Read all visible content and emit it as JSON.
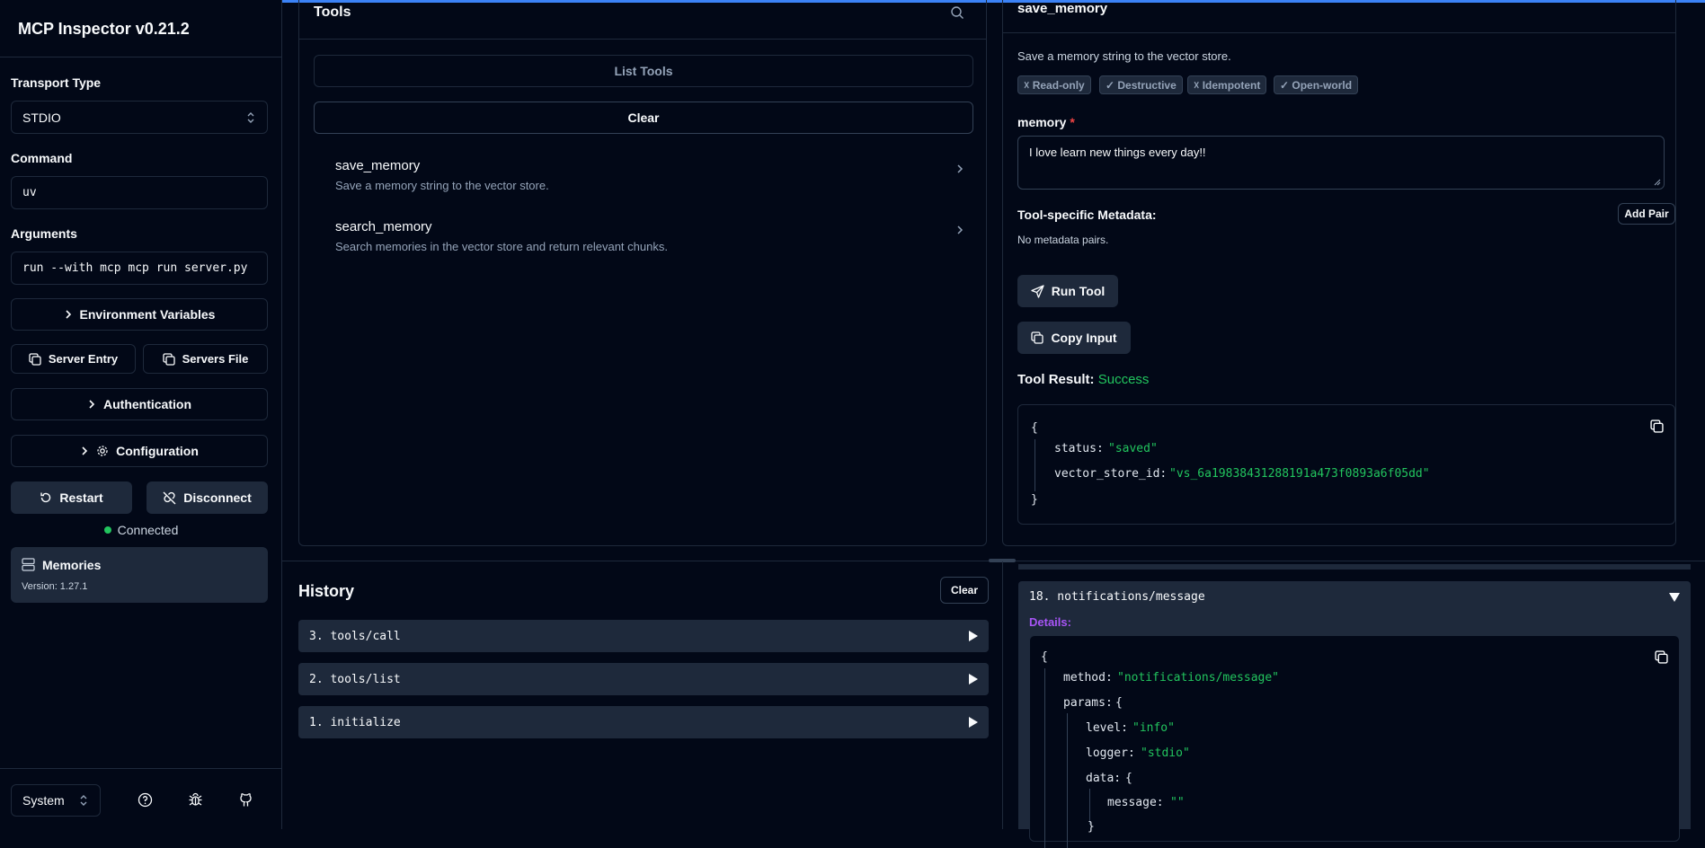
{
  "app": {
    "title": "MCP Inspector v0.21.2"
  },
  "sidebar": {
    "transport_label": "Transport Type",
    "transport_value": "STDIO",
    "command_label": "Command",
    "command_value": "uv",
    "arguments_label": "Arguments",
    "arguments_value": "run --with mcp mcp run server.py",
    "env_vars": "Environment Variables",
    "server_entry": "Server Entry",
    "servers_file": "Servers File",
    "authentication": "Authentication",
    "configuration": "Configuration",
    "restart": "Restart",
    "disconnect": "Disconnect",
    "status": "Connected",
    "server_name": "Memories",
    "server_version": "Version: 1.27.1",
    "theme": "System"
  },
  "tools": {
    "title": "Tools",
    "list_tools": "List Tools",
    "clear": "Clear",
    "items": [
      {
        "name": "save_memory",
        "desc": "Save a memory string to the vector store."
      },
      {
        "name": "search_memory",
        "desc": "Search memories in the vector store and return relevant chunks."
      }
    ]
  },
  "detail": {
    "title": "save_memory",
    "desc": "Save a memory string to the vector store.",
    "badges": [
      "☓ Read-only",
      "✓ Destructive",
      "☓ Idempotent",
      "✓ Open-world"
    ],
    "memory_label": "memory",
    "required_mark": "*",
    "memory_value": "I love learn new things every day!!",
    "metadata_label": "Tool-specific Metadata:",
    "add_pair": "Add Pair",
    "no_metadata": "No metadata pairs.",
    "run_tool": "Run Tool",
    "copy_input": "Copy Input",
    "result_label": "Tool Result:",
    "result_status": "Success",
    "result": {
      "open": "{",
      "status_key": "status:",
      "status_val": "\"saved\"",
      "vs_key": "vector_store_id:",
      "vs_val": "\"vs_6a19838431288191a473f0893a6f05dd\"",
      "close": "}"
    }
  },
  "history": {
    "title": "History",
    "clear": "Clear",
    "items": [
      "3. tools/call",
      "2. tools/list",
      "1. initialize"
    ]
  },
  "notifications": {
    "header": "18. notifications/message",
    "details_label": "Details:",
    "json": {
      "open": "{",
      "method_key": "method:",
      "method_val": "\"notifications/message\"",
      "params_key": "params:",
      "params_open": "{",
      "level_key": "level:",
      "level_val": "\"info\"",
      "logger_key": "logger:",
      "logger_val": "\"stdio\"",
      "data_key": "data:",
      "data_open": "{",
      "message_key": "message:",
      "message_val": "\"\"",
      "close": "}"
    }
  },
  "colors": {
    "accent": "#3b82f6",
    "success": "#22c55e",
    "details": "#a855f7",
    "required": "#ef4444"
  }
}
